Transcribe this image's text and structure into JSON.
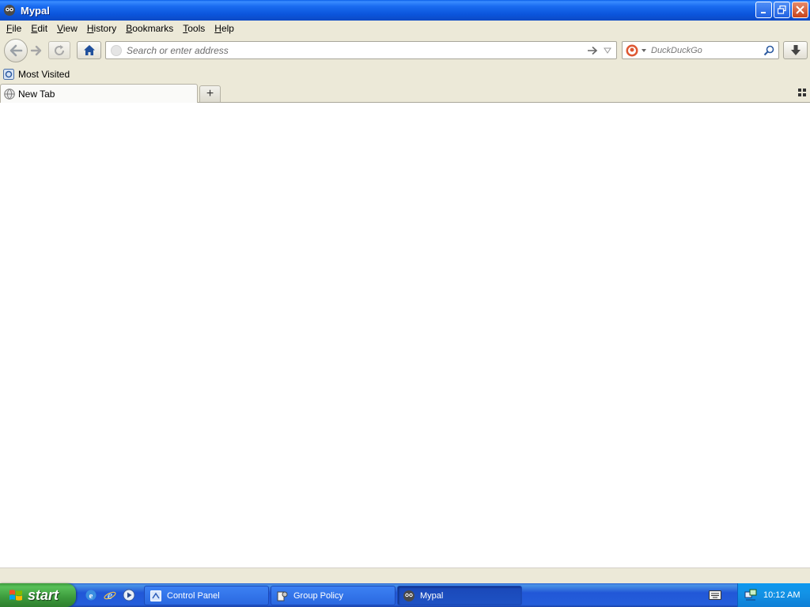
{
  "window": {
    "title": "Mypal",
    "controls": [
      "minimize",
      "restore",
      "close"
    ]
  },
  "menubar": {
    "items": [
      {
        "label": "File",
        "access": "F",
        "rest": "ile"
      },
      {
        "label": "Edit",
        "access": "E",
        "rest": "dit"
      },
      {
        "label": "View",
        "access": "V",
        "rest": "iew"
      },
      {
        "label": "History",
        "access": "H",
        "rest": "istory"
      },
      {
        "label": "Bookmarks",
        "access": "B",
        "rest": "ookmarks"
      },
      {
        "label": "Tools",
        "access": "T",
        "rest": "ools"
      },
      {
        "label": "Help",
        "access": "H",
        "rest": "elp"
      }
    ]
  },
  "navbar": {
    "url_placeholder": "Search or enter address",
    "url_value": "",
    "search_placeholder": "DuckDuckGo",
    "search_engine_icon": "duckduckgo-icon"
  },
  "bookmarks": {
    "items": [
      {
        "label": "Most Visited",
        "icon": "most-visited-icon"
      }
    ]
  },
  "tabs": {
    "items": [
      {
        "label": "New Tab",
        "active": true
      }
    ],
    "new_tab_symbol": "+"
  },
  "taskbar": {
    "start_label": "start",
    "quick_launch": [
      "ie-icon",
      "firefox-icon",
      "media-player-icon"
    ],
    "tasks": [
      {
        "label": "Control Panel",
        "active": false
      },
      {
        "label": "Group Policy",
        "active": false
      },
      {
        "label": "Mypal",
        "active": true
      }
    ],
    "clock": "10:12 AM"
  },
  "colors": {
    "titlebar": "#0b55dc",
    "chrome": "#ece9d8",
    "taskbar": "#245edb",
    "start": "#3c9a3c",
    "tray": "#1393e6"
  }
}
